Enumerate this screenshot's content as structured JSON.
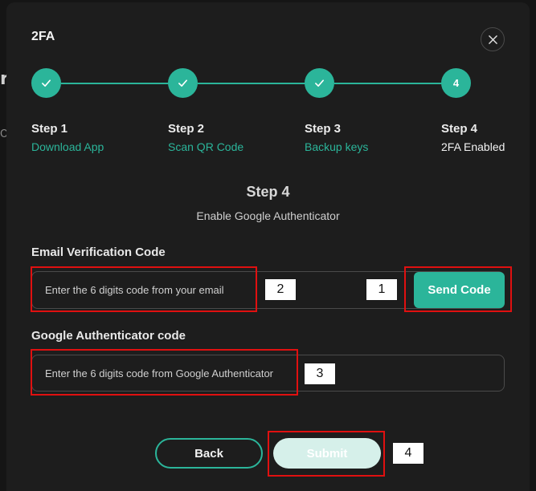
{
  "backdrop": {
    "fragment_top": "r",
    "fragment_bottom": "O"
  },
  "modal": {
    "title": "2FA"
  },
  "steps": [
    {
      "title": "Step 1",
      "subtitle": "Download App",
      "done": true
    },
    {
      "title": "Step 2",
      "subtitle": "Scan QR Code",
      "done": true
    },
    {
      "title": "Step 3",
      "subtitle": "Backup keys",
      "done": true
    },
    {
      "title": "Step 4",
      "subtitle": "2FA Enabled",
      "done": false,
      "number": "4"
    }
  ],
  "section": {
    "heading": "Step 4",
    "description": "Enable Google Authenticator"
  },
  "email_field": {
    "label": "Email Verification Code",
    "placeholder": "Enter the 6 digits code from your email",
    "value": "",
    "send_label": "Send Code"
  },
  "ga_field": {
    "label": "Google Authenticator code",
    "placeholder": "Enter the 6 digits code from Google Authenticator",
    "value": ""
  },
  "actions": {
    "back_label": "Back",
    "submit_label": "Submit"
  },
  "annotations": [
    "1",
    "2",
    "3",
    "4"
  ],
  "colors": {
    "accent": "#2bb59a",
    "background": "#1d1d1d",
    "annotation": "#e01010",
    "submit_disabled": "#d6f0ea"
  }
}
